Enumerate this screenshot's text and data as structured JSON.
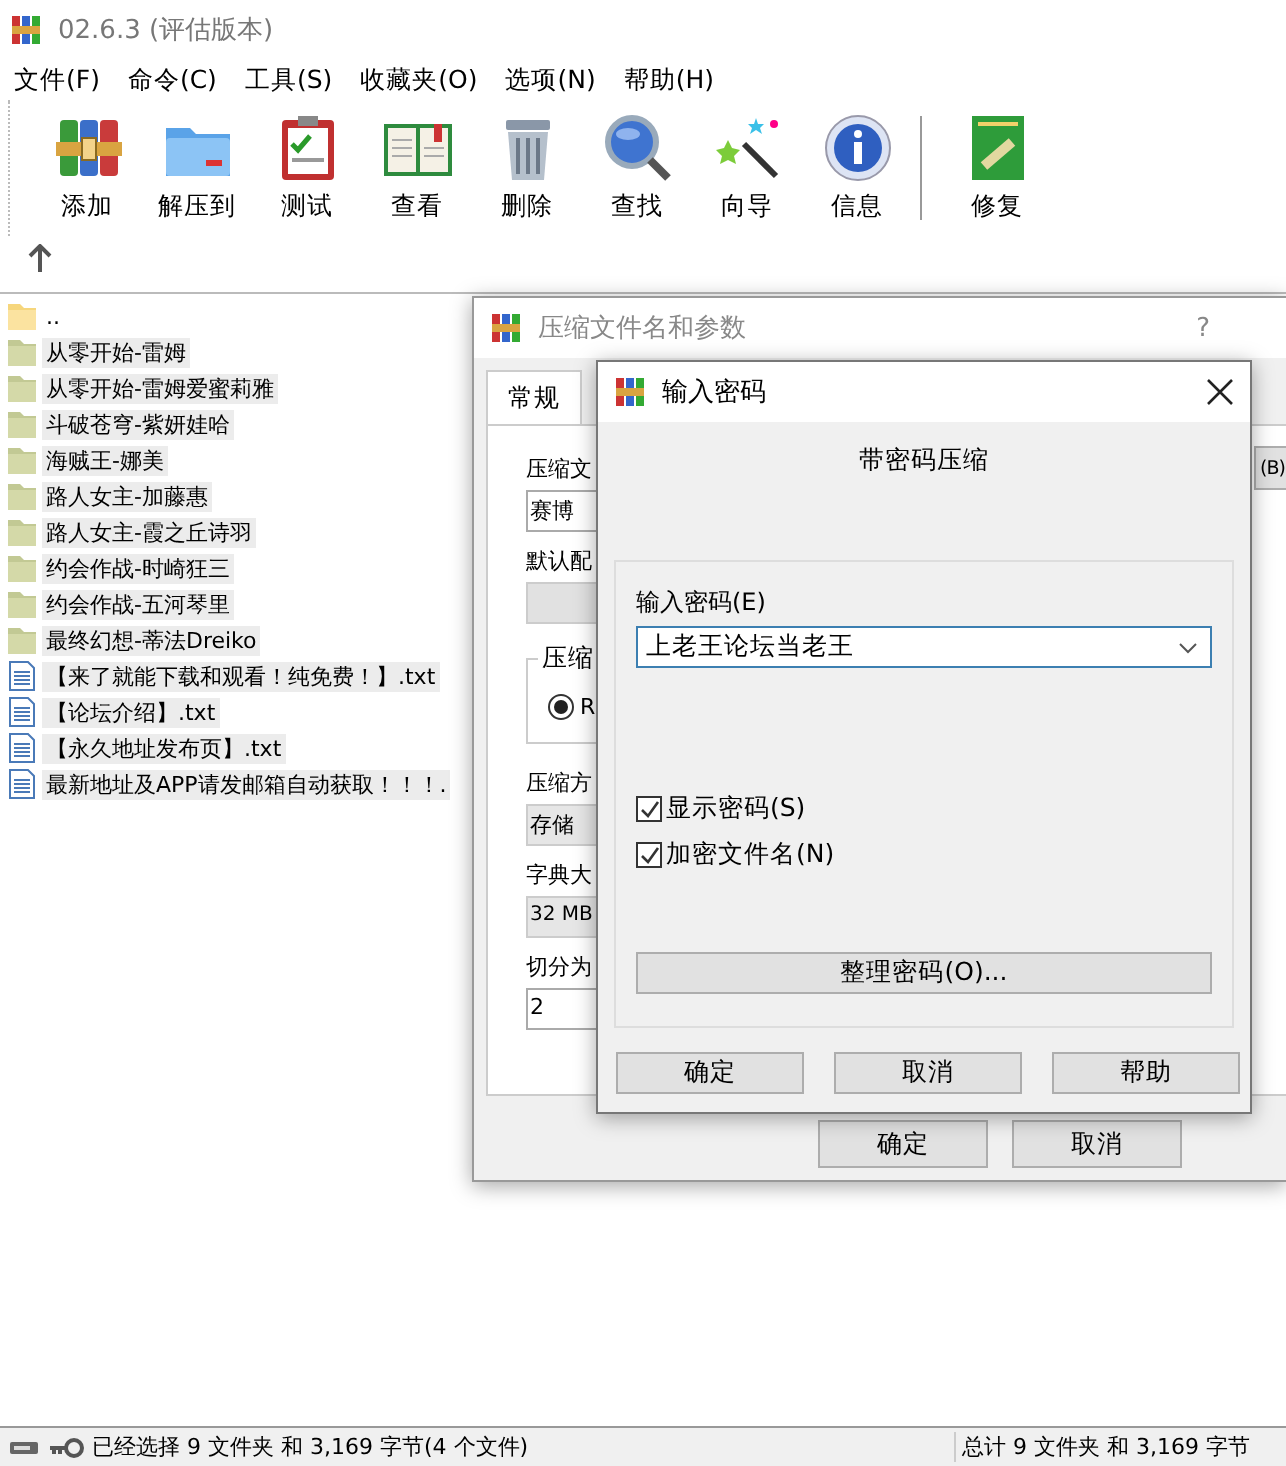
{
  "window": {
    "title": "02.6.3 (评估版本)"
  },
  "menu": [
    "文件(F)",
    "命令(C)",
    "工具(S)",
    "收藏夹(O)",
    "选项(N)",
    "帮助(H)"
  ],
  "toolbar": [
    {
      "label": "添加",
      "kind": "add"
    },
    {
      "label": "解压到",
      "kind": "extract"
    },
    {
      "label": "测试",
      "kind": "test"
    },
    {
      "label": "查看",
      "kind": "view"
    },
    {
      "label": "删除",
      "kind": "delete"
    },
    {
      "label": "查找",
      "kind": "find"
    },
    {
      "label": "向导",
      "kind": "wizard"
    },
    {
      "label": "信息",
      "kind": "info"
    },
    {
      "label": "修复",
      "kind": "repair",
      "separated": true
    }
  ],
  "files": [
    {
      "name": "..",
      "kind": "parent",
      "selected": false
    },
    {
      "name": "从零开始-雷姆",
      "kind": "folder",
      "selected": true
    },
    {
      "name": "从零开始-雷姆爱蜜莉雅",
      "kind": "folder",
      "selected": true
    },
    {
      "name": "斗破苍穹-紫妍娃哈",
      "kind": "folder",
      "selected": true
    },
    {
      "name": "海贼王-娜美",
      "kind": "folder",
      "selected": true
    },
    {
      "name": "路人女主-加藤惠",
      "kind": "folder",
      "selected": true
    },
    {
      "name": "路人女主-霞之丘诗羽",
      "kind": "folder",
      "selected": true
    },
    {
      "name": "约会作战-时崎狂三",
      "kind": "folder",
      "selected": true
    },
    {
      "name": "约会作战-五河琴里",
      "kind": "folder",
      "selected": true
    },
    {
      "name": "最终幻想-蒂法Dreiko",
      "kind": "folder",
      "selected": true
    },
    {
      "name": "【来了就能下载和观看！纯免费！】.txt",
      "kind": "text",
      "selected": true
    },
    {
      "name": "【论坛介绍】.txt",
      "kind": "text",
      "selected": true
    },
    {
      "name": "【永久地址发布页】.txt",
      "kind": "text",
      "selected": true
    },
    {
      "name": "最新地址及APP请发邮箱自动获取！！！.",
      "kind": "text",
      "selected": true
    }
  ],
  "archive_dialog": {
    "title": "压缩文件名和参数",
    "help": "?",
    "tabs": [
      {
        "label": "常规",
        "selected": true
      }
    ],
    "archive_name_label": "压缩文",
    "archive_name": "赛博",
    "browse": "(B)",
    "profile_label": "默认配",
    "format_group_label": "压缩",
    "format_options": [
      {
        "label": "R",
        "selected": true
      }
    ],
    "method_label": "压缩方",
    "method": "存储",
    "dictionary_label": "字典大",
    "dictionary": "32 MB",
    "split_label": "切分为",
    "split": "2",
    "buttons": [
      "确定",
      "取消"
    ]
  },
  "password_dialog": {
    "title": "输入密码",
    "heading": "带密码压缩",
    "password_label": "输入密码(E)",
    "password": "上老王论坛当老王",
    "options": [
      {
        "label": "显示密码(S)",
        "checked": true
      },
      {
        "label": "加密文件名(N)",
        "checked": true
      }
    ],
    "organize_button": "整理密码(O)...",
    "buttons": [
      "确定",
      "取消",
      "帮助"
    ]
  },
  "status_bar": {
    "left": "已经选择 9 文件夹 和 3,169 字节(4 个文件)",
    "right": "总计 9 文件夹 和 3,169 字节"
  }
}
